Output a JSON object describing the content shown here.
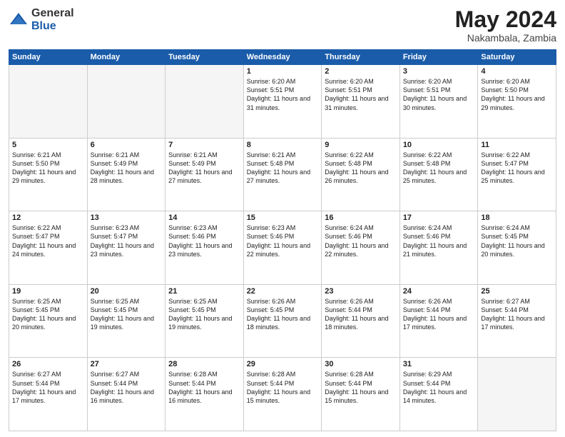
{
  "header": {
    "logo_general": "General",
    "logo_blue": "Blue",
    "month_year": "May 2024",
    "location": "Nakambala, Zambia"
  },
  "days_of_week": [
    "Sunday",
    "Monday",
    "Tuesday",
    "Wednesday",
    "Thursday",
    "Friday",
    "Saturday"
  ],
  "weeks": [
    [
      {
        "day": "",
        "info": ""
      },
      {
        "day": "",
        "info": ""
      },
      {
        "day": "",
        "info": ""
      },
      {
        "day": "1",
        "info": "Sunrise: 6:20 AM\nSunset: 5:51 PM\nDaylight: 11 hours\nand 31 minutes."
      },
      {
        "day": "2",
        "info": "Sunrise: 6:20 AM\nSunset: 5:51 PM\nDaylight: 11 hours\nand 31 minutes."
      },
      {
        "day": "3",
        "info": "Sunrise: 6:20 AM\nSunset: 5:51 PM\nDaylight: 11 hours\nand 30 minutes."
      },
      {
        "day": "4",
        "info": "Sunrise: 6:20 AM\nSunset: 5:50 PM\nDaylight: 11 hours\nand 29 minutes."
      }
    ],
    [
      {
        "day": "5",
        "info": "Sunrise: 6:21 AM\nSunset: 5:50 PM\nDaylight: 11 hours\nand 29 minutes."
      },
      {
        "day": "6",
        "info": "Sunrise: 6:21 AM\nSunset: 5:49 PM\nDaylight: 11 hours\nand 28 minutes."
      },
      {
        "day": "7",
        "info": "Sunrise: 6:21 AM\nSunset: 5:49 PM\nDaylight: 11 hours\nand 27 minutes."
      },
      {
        "day": "8",
        "info": "Sunrise: 6:21 AM\nSunset: 5:48 PM\nDaylight: 11 hours\nand 27 minutes."
      },
      {
        "day": "9",
        "info": "Sunrise: 6:22 AM\nSunset: 5:48 PM\nDaylight: 11 hours\nand 26 minutes."
      },
      {
        "day": "10",
        "info": "Sunrise: 6:22 AM\nSunset: 5:48 PM\nDaylight: 11 hours\nand 25 minutes."
      },
      {
        "day": "11",
        "info": "Sunrise: 6:22 AM\nSunset: 5:47 PM\nDaylight: 11 hours\nand 25 minutes."
      }
    ],
    [
      {
        "day": "12",
        "info": "Sunrise: 6:22 AM\nSunset: 5:47 PM\nDaylight: 11 hours\nand 24 minutes."
      },
      {
        "day": "13",
        "info": "Sunrise: 6:23 AM\nSunset: 5:47 PM\nDaylight: 11 hours\nand 23 minutes."
      },
      {
        "day": "14",
        "info": "Sunrise: 6:23 AM\nSunset: 5:46 PM\nDaylight: 11 hours\nand 23 minutes."
      },
      {
        "day": "15",
        "info": "Sunrise: 6:23 AM\nSunset: 5:46 PM\nDaylight: 11 hours\nand 22 minutes."
      },
      {
        "day": "16",
        "info": "Sunrise: 6:24 AM\nSunset: 5:46 PM\nDaylight: 11 hours\nand 22 minutes."
      },
      {
        "day": "17",
        "info": "Sunrise: 6:24 AM\nSunset: 5:46 PM\nDaylight: 11 hours\nand 21 minutes."
      },
      {
        "day": "18",
        "info": "Sunrise: 6:24 AM\nSunset: 5:45 PM\nDaylight: 11 hours\nand 20 minutes."
      }
    ],
    [
      {
        "day": "19",
        "info": "Sunrise: 6:25 AM\nSunset: 5:45 PM\nDaylight: 11 hours\nand 20 minutes."
      },
      {
        "day": "20",
        "info": "Sunrise: 6:25 AM\nSunset: 5:45 PM\nDaylight: 11 hours\nand 19 minutes."
      },
      {
        "day": "21",
        "info": "Sunrise: 6:25 AM\nSunset: 5:45 PM\nDaylight: 11 hours\nand 19 minutes."
      },
      {
        "day": "22",
        "info": "Sunrise: 6:26 AM\nSunset: 5:45 PM\nDaylight: 11 hours\nand 18 minutes."
      },
      {
        "day": "23",
        "info": "Sunrise: 6:26 AM\nSunset: 5:44 PM\nDaylight: 11 hours\nand 18 minutes."
      },
      {
        "day": "24",
        "info": "Sunrise: 6:26 AM\nSunset: 5:44 PM\nDaylight: 11 hours\nand 17 minutes."
      },
      {
        "day": "25",
        "info": "Sunrise: 6:27 AM\nSunset: 5:44 PM\nDaylight: 11 hours\nand 17 minutes."
      }
    ],
    [
      {
        "day": "26",
        "info": "Sunrise: 6:27 AM\nSunset: 5:44 PM\nDaylight: 11 hours\nand 17 minutes."
      },
      {
        "day": "27",
        "info": "Sunrise: 6:27 AM\nSunset: 5:44 PM\nDaylight: 11 hours\nand 16 minutes."
      },
      {
        "day": "28",
        "info": "Sunrise: 6:28 AM\nSunset: 5:44 PM\nDaylight: 11 hours\nand 16 minutes."
      },
      {
        "day": "29",
        "info": "Sunrise: 6:28 AM\nSunset: 5:44 PM\nDaylight: 11 hours\nand 15 minutes."
      },
      {
        "day": "30",
        "info": "Sunrise: 6:28 AM\nSunset: 5:44 PM\nDaylight: 11 hours\nand 15 minutes."
      },
      {
        "day": "31",
        "info": "Sunrise: 6:29 AM\nSunset: 5:44 PM\nDaylight: 11 hours\nand 14 minutes."
      },
      {
        "day": "",
        "info": ""
      }
    ]
  ]
}
